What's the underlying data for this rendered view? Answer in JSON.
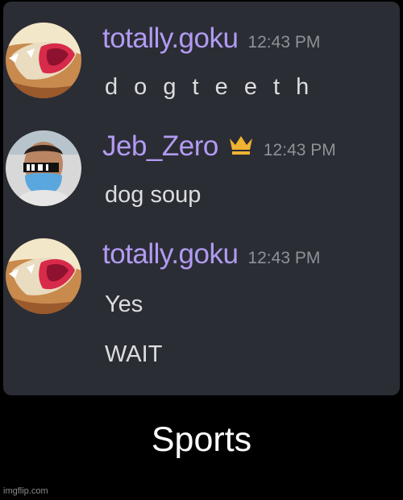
{
  "messages": [
    {
      "username": "totally.goku",
      "timestamp": "12:43 PM",
      "lines": [
        "d o g t e e t h"
      ],
      "avatar_icon": "goku-mouth-avatar"
    },
    {
      "username": "Jeb_Zero",
      "timestamp": "12:43 PM",
      "lines": [
        "dog soup"
      ],
      "avatar_icon": "masked-person-avatar",
      "badge_icon": "crown-icon"
    },
    {
      "username": "totally.goku",
      "timestamp": "12:43 PM",
      "lines": [
        "Yes",
        "WAIT"
      ],
      "avatar_icon": "goku-mouth-avatar"
    }
  ],
  "caption": "Sports",
  "watermark": "imgflip.com",
  "colors": {
    "background": "#000000",
    "panel": "#2b2d35",
    "username": "#b29bf2",
    "timestamp": "#8e9297",
    "message_text": "#dcddde",
    "crown": "#f0b232"
  }
}
